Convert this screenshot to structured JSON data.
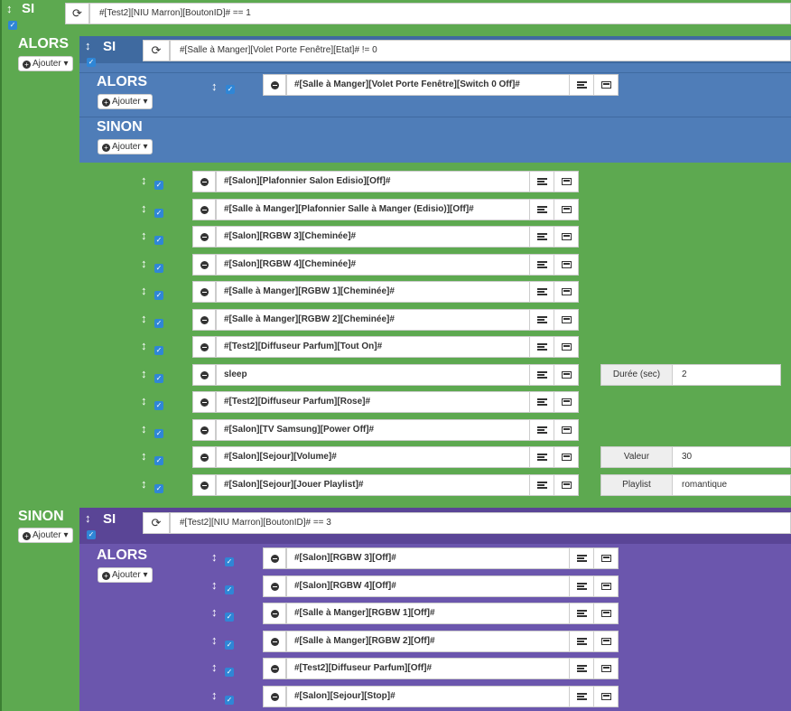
{
  "main": {
    "si_label": "SI",
    "alors_label": "ALORS",
    "sinon_label": "SINON",
    "ajouter_label": "Ajouter",
    "condition": "#[Test2][NIU Marron][BoutonID]# == 1"
  },
  "nested_si": {
    "si_label": "SI",
    "alors_label": "ALORS",
    "sinon_label": "SINON",
    "ajouter_label": "Ajouter",
    "condition": "#[Salle à Manger][Volet Porte Fenêtre][Etat]# != 0",
    "alors_commands": [
      {
        "text": "#[Salle à Manger][Volet Porte Fenêtre][Switch 0 Off]#"
      }
    ]
  },
  "alors_commands": [
    {
      "text": "#[Salon][Plafonnier Salon Edisio][Off]#"
    },
    {
      "text": "#[Salle à Manger][Plafonnier Salle à Manger (Edisio)][Off]#"
    },
    {
      "text": "#[Salon][RGBW 3][Cheminée]#"
    },
    {
      "text": "#[Salon][RGBW 4][Cheminée]#"
    },
    {
      "text": "#[Salle à Manger][RGBW 1][Cheminée]#"
    },
    {
      "text": "#[Salle à Manger][RGBW 2][Cheminée]#"
    },
    {
      "text": "#[Test2][Diffuseur Parfum][Tout On]#"
    },
    {
      "text": "sleep",
      "option_label": "Durée (sec)",
      "option_value": "2"
    },
    {
      "text": "#[Test2][Diffuseur Parfum][Rose]#"
    },
    {
      "text": "#[Salon][TV Samsung][Power Off]#"
    },
    {
      "text": "#[Salon][Sejour][Volume]#",
      "option_label": "Valeur",
      "option_value": "30"
    },
    {
      "text": "#[Salon][Sejour][Jouer Playlist]#",
      "option_label": "Playlist",
      "option_value": "romantique"
    }
  ],
  "sinon_si": {
    "si_label": "SI",
    "alors_label": "ALORS",
    "ajouter_label": "Ajouter",
    "condition": "#[Test2][NIU Marron][BoutonID]# == 3",
    "alors_commands": [
      {
        "text": "#[Salon][RGBW 3][Off]#"
      },
      {
        "text": "#[Salon][RGBW 4][Off]#"
      },
      {
        "text": "#[Salle à Manger][RGBW 1][Off]#"
      },
      {
        "text": "#[Salle à Manger][RGBW 2][Off]#"
      },
      {
        "text": "#[Test2][Diffuseur Parfum][Off]#"
      },
      {
        "text": "#[Salon][Sejour][Stop]#"
      }
    ]
  },
  "icons": {
    "move": "↕",
    "check": "✓",
    "refresh": "⟳",
    "caret": "▾"
  },
  "colors": {
    "green": "#5da950",
    "blue": "#4f7db8",
    "purple": "#6b56ad",
    "checkbox": "#2f86d6"
  }
}
